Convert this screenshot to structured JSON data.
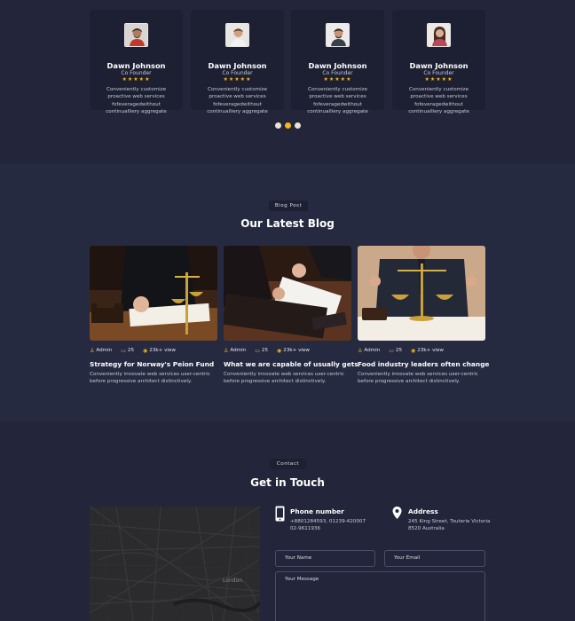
{
  "testimonials": {
    "cards": [
      {
        "name": "Dawn Johnson",
        "role": "Co Founder",
        "stars": "★★★★★",
        "text": "Conveniently customize proactive web services fofeveragedwithout continualliery aggregate"
      },
      {
        "name": "Dawn Johnson",
        "role": "Co Founder",
        "stars": "★★★★★",
        "text": "Conveniently customize proactive web services fofeveragedwithout continualliery aggregate"
      },
      {
        "name": "Dawn Johnson",
        "role": "Co Founder",
        "stars": "★★★★★",
        "text": "Conveniently customize proactive web services fofeveragedwithout continualliery aggregate"
      },
      {
        "name": "Dawn Johnson",
        "role": "Co Founder",
        "stars": "★★★★★",
        "text": "Conveniently customize proactive web services fofeveragedwithout continualliery aggregate"
      }
    ],
    "active_dot": 2
  },
  "blog": {
    "tag": "Blog Post",
    "title": "Our Latest Blog",
    "posts": [
      {
        "author": "Admin",
        "comments": "25",
        "views": "23k+ view",
        "title": "Strategy for Norway's Peion Fund",
        "desc": "Conveniently innovate web services user-centric before progressive architect distinctively."
      },
      {
        "author": "Admin",
        "comments": "25",
        "views": "23k+ view",
        "title": "What we are capable of usually gets",
        "desc": "Conveniently innovate web services user-centric before progressive architect distinctively."
      },
      {
        "author": "Admin",
        "comments": "25",
        "views": "23k+ view",
        "title": "Food industry leaders often change",
        "desc": "Conveniently innovate web services user-centric before progressive architect distinctively."
      }
    ]
  },
  "contact": {
    "tag": "Contact",
    "title": "Get in Touch",
    "map_label": "London",
    "phone": {
      "title": "Phone number",
      "line1": "+8801284593, 01239-420007",
      "line2": "02-9611936"
    },
    "address": {
      "title": "Address",
      "line1": "245 King Street, Touterie Victoria",
      "line2": "8520 Australia"
    },
    "form": {
      "name_placeholder": "Your Name",
      "email_placeholder": "Your Email",
      "message_placeholder": "Your Message"
    }
  },
  "colors": {
    "accent": "#f4b41a",
    "background": "#23263a",
    "card": "#1d2032"
  }
}
